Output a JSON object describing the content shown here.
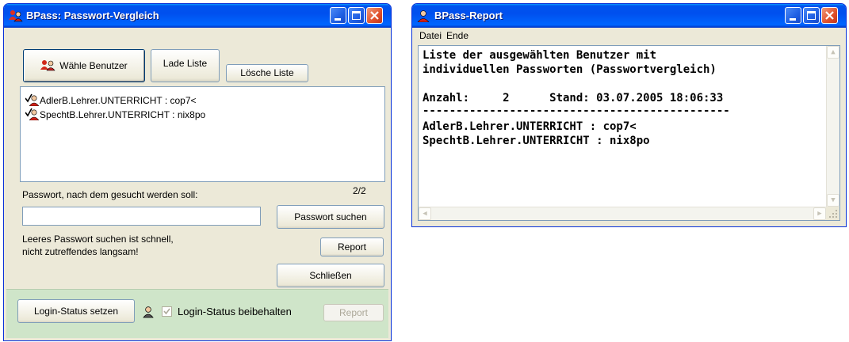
{
  "compare_window": {
    "title": "BPass: Passwort-Vergleich",
    "buttons": {
      "choose_users": "Wähle Benutzer",
      "load_list": "Lade Liste",
      "clear_list": "Lösche Liste",
      "search_password": "Passwort suchen",
      "report": "Report",
      "close": "Schließen",
      "set_login_status": "Login-Status setzen",
      "report_disabled": "Report"
    },
    "user_list": [
      "AdlerB.Lehrer.UNTERRICHT : cop7<",
      "SpechtB.Lehrer.UNTERRICHT : nix8po"
    ],
    "list_count": "2/2",
    "search_label": "Passwort, nach dem gesucht werden soll:",
    "search_value": "",
    "hint_line1": "Leeres Passwort suchen ist schnell,",
    "hint_line2": "nicht zutreffendes langsam!",
    "keep_login_status_label": "Login-Status beibehalten",
    "keep_login_status_checked": true
  },
  "report_window": {
    "title": "BPass-Report",
    "menu": [
      "Datei",
      "Ende"
    ],
    "lines": {
      "l1": "Liste der ausgewählten Benutzer mit",
      "l2": "individuellen Passworten (Passwortvergleich)",
      "l3": "Anzahl:     2      Stand: 03.07.2005 18:06:33",
      "l4": "----------------------------------------------",
      "l5": "AdlerB.Lehrer.UNTERRICHT : cop7<",
      "l6": "SpechtB.Lehrer.UNTERRICHT : nix8po"
    }
  },
  "colors": {
    "titlebar": "#0054e3",
    "close_button": "#e0502a",
    "panel": "#ece9d8",
    "login_panel": "#cfe5c9"
  }
}
